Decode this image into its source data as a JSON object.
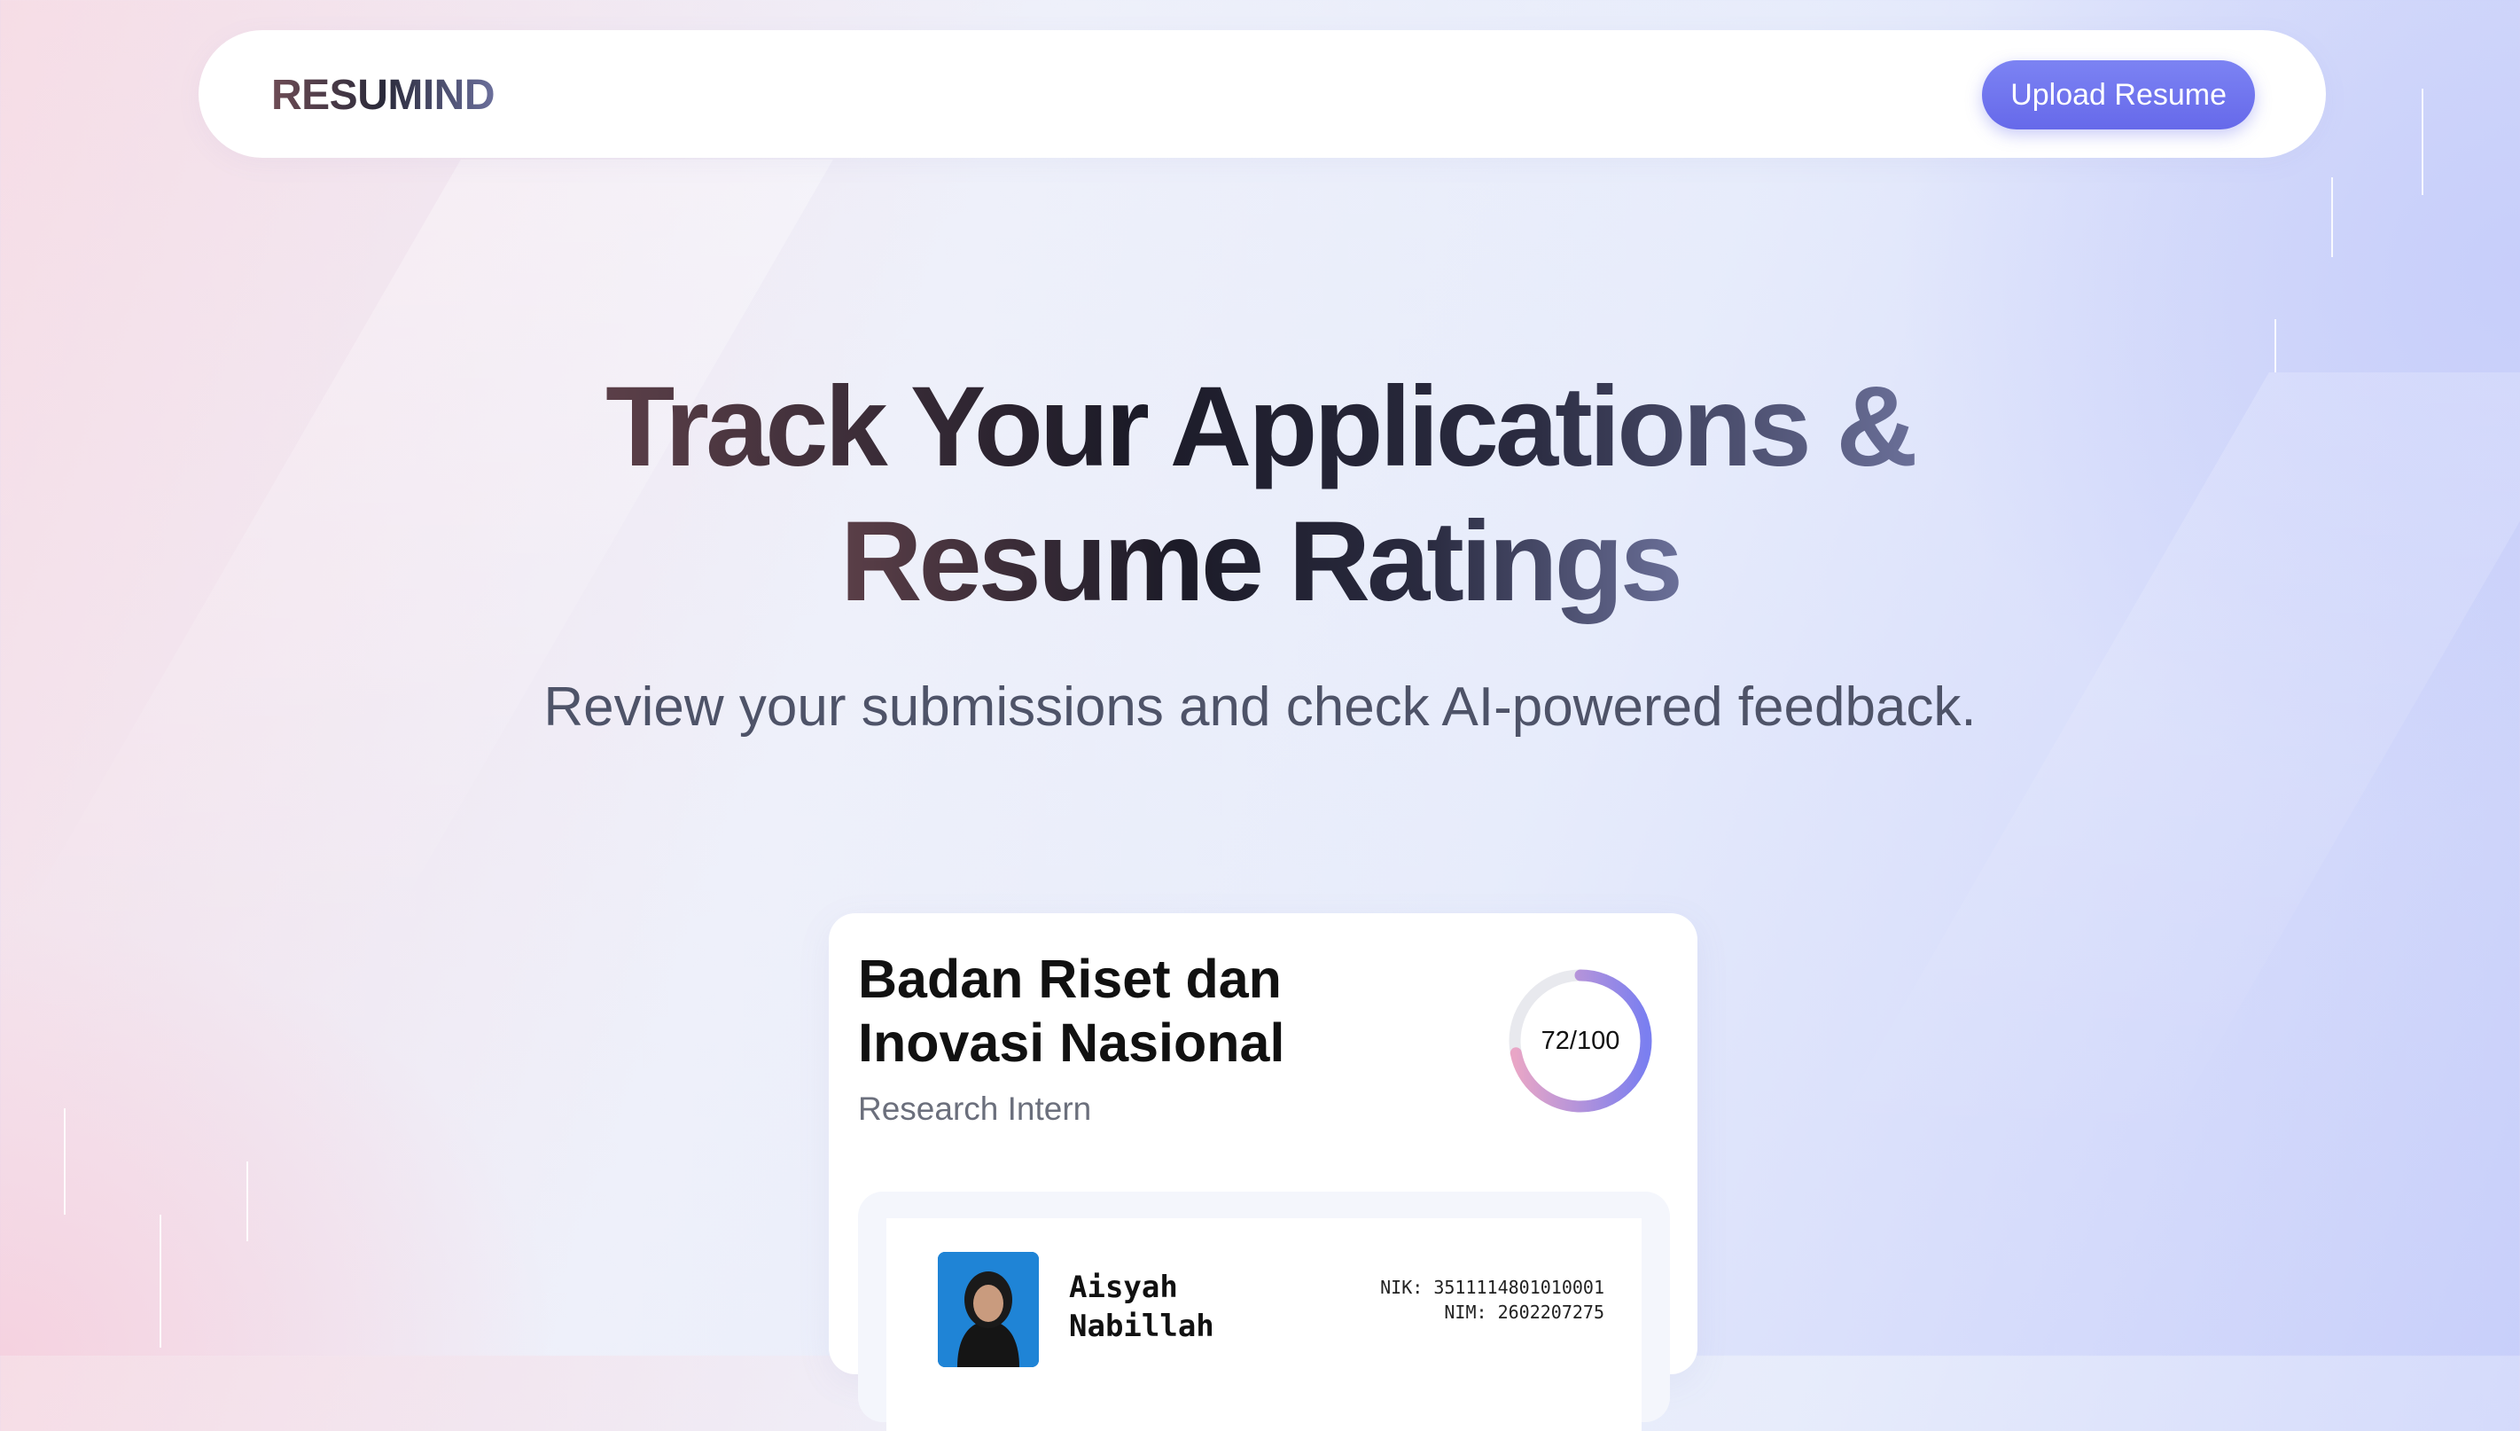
{
  "nav": {
    "logo": "RESUMIND",
    "upload_label": "Upload Resume"
  },
  "hero": {
    "title_line1": "Track Your Applications &",
    "title_line2": "Resume Ratings",
    "subtitle": "Review your submissions and check AI-powered feedback."
  },
  "card": {
    "company": "Badan Riset dan Inovasi Nasional",
    "role": "Research Intern",
    "score_text": "72/100",
    "score_value": 72,
    "score_max": 100,
    "preview": {
      "name": "Aisyah Nabillah",
      "nik": "NIK: 3511114801010001",
      "nim": "NIM: 2602207275"
    }
  },
  "colors": {
    "accent": "#6669ea",
    "score_gradient_start": "#e9a6c6",
    "score_gradient_end": "#7b7ff0"
  }
}
